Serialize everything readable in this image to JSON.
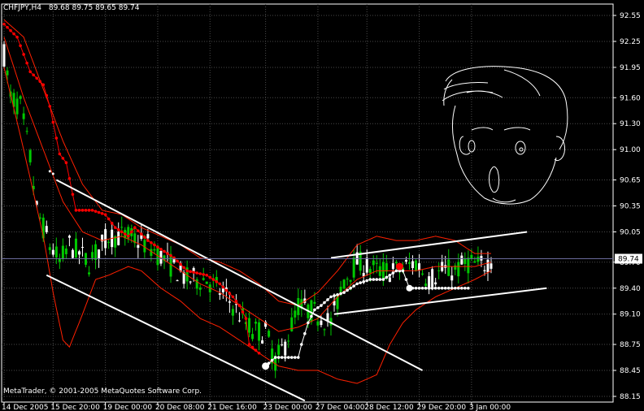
{
  "header": {
    "symbol": "CHFJPY,H4",
    "quote": "89.68 89.75 89.65 89.74"
  },
  "footer": {
    "copyright": "MetaTrader, © 2001-2005 MetaQuotes Software Corp."
  },
  "current_price": {
    "label": "89.74",
    "value": 89.74
  },
  "colors": {
    "background": "#000000",
    "grid": "#4a4a4a",
    "axis": "#ffffff",
    "candle_up": "#ffffff",
    "candle_down": "#00c800",
    "bollinger": "#ff2000",
    "sar": "#ff0000",
    "step_line": "#ffffff",
    "trendline": "#ffffff"
  },
  "chart_data": {
    "type": "candlestick",
    "title": "CHFJPY,H4",
    "ylim": [
      88.15,
      92.55
    ],
    "y_ticks": [
      92.55,
      92.25,
      91.95,
      91.6,
      91.3,
      91.0,
      90.65,
      90.35,
      90.05,
      89.7,
      89.4,
      89.1,
      88.75,
      88.45,
      88.15
    ],
    "y_tick_labels": [
      "92.55",
      "92.25",
      "91.95",
      "91.60",
      "91.30",
      "91.00",
      "90.65",
      "90.35",
      "90.05",
      "89.70",
      "89.40",
      "89.10",
      "88.75",
      "88.45",
      "88.15"
    ],
    "x_labels": [
      {
        "bar": 0,
        "label": "14 Dec 2005"
      },
      {
        "bar": 15,
        "label": "15 Dec 20:00"
      },
      {
        "bar": 31,
        "label": "19 Dec 00:00"
      },
      {
        "bar": 47,
        "label": "20 Dec 08:00"
      },
      {
        "bar": 63,
        "label": "21 Dec 16:00"
      },
      {
        "bar": 80,
        "label": "23 Dec 00:00"
      },
      {
        "bar": 96,
        "label": "27 Dec 04:00"
      },
      {
        "bar": 111,
        "label": "28 Dec 12:00"
      },
      {
        "bar": 127,
        "label": "29 Dec 20:00"
      },
      {
        "bar": 143,
        "label": "3 Jan 00:00"
      }
    ],
    "bar_count": 150,
    "series": [
      {
        "kind": "price",
        "anchors": [
          [
            0,
            92.1
          ],
          [
            2,
            91.6
          ],
          [
            5,
            91.5
          ],
          [
            8,
            90.9
          ],
          [
            10,
            90.3
          ],
          [
            14,
            89.9
          ],
          [
            17,
            89.7
          ],
          [
            20,
            89.9
          ],
          [
            26,
            89.7
          ],
          [
            32,
            90.0
          ],
          [
            38,
            90.0
          ],
          [
            44,
            89.9
          ],
          [
            50,
            89.7
          ],
          [
            56,
            89.5
          ],
          [
            62,
            89.5
          ],
          [
            68,
            89.3
          ],
          [
            72,
            89.1
          ],
          [
            76,
            88.9
          ],
          [
            80,
            88.9
          ],
          [
            83,
            88.55
          ],
          [
            86,
            88.75
          ],
          [
            90,
            89.2
          ],
          [
            96,
            89.1
          ],
          [
            100,
            89.0
          ],
          [
            104,
            89.5
          ],
          [
            108,
            89.7
          ],
          [
            114,
            89.6
          ],
          [
            120,
            89.6
          ],
          [
            126,
            89.7
          ],
          [
            130,
            89.5
          ],
          [
            134,
            89.6
          ],
          [
            138,
            89.6
          ],
          [
            142,
            89.7
          ],
          [
            146,
            89.65
          ],
          [
            149,
            89.74
          ]
        ]
      },
      {
        "name": "bollinger-upper",
        "kind": "line",
        "anchors": [
          [
            0,
            92.5
          ],
          [
            6,
            92.3
          ],
          [
            12,
            91.7
          ],
          [
            18,
            91.1
          ],
          [
            24,
            90.6
          ],
          [
            30,
            90.3
          ],
          [
            36,
            90.25
          ],
          [
            42,
            90.1
          ],
          [
            48,
            90.0
          ],
          [
            54,
            89.9
          ],
          [
            60,
            89.75
          ],
          [
            66,
            89.7
          ],
          [
            72,
            89.6
          ],
          [
            78,
            89.45
          ],
          [
            84,
            89.25
          ],
          [
            90,
            89.2
          ],
          [
            96,
            89.35
          ],
          [
            102,
            89.6
          ],
          [
            108,
            89.9
          ],
          [
            114,
            90.0
          ],
          [
            120,
            89.95
          ],
          [
            126,
            89.95
          ],
          [
            132,
            90.0
          ],
          [
            138,
            89.95
          ],
          [
            144,
            89.8
          ],
          [
            149,
            89.8
          ]
        ]
      },
      {
        "name": "bollinger-middle",
        "kind": "line",
        "anchors": [
          [
            0,
            92.3
          ],
          [
            6,
            91.6
          ],
          [
            12,
            91.0
          ],
          [
            18,
            90.4
          ],
          [
            24,
            90.05
          ],
          [
            30,
            89.95
          ],
          [
            36,
            90.0
          ],
          [
            42,
            89.9
          ],
          [
            48,
            89.75
          ],
          [
            54,
            89.6
          ],
          [
            60,
            89.45
          ],
          [
            66,
            89.35
          ],
          [
            72,
            89.2
          ],
          [
            78,
            89.05
          ],
          [
            84,
            88.9
          ],
          [
            90,
            88.95
          ],
          [
            96,
            89.05
          ],
          [
            102,
            89.3
          ],
          [
            108,
            89.5
          ],
          [
            114,
            89.6
          ],
          [
            120,
            89.6
          ],
          [
            126,
            89.6
          ],
          [
            132,
            89.65
          ],
          [
            138,
            89.65
          ],
          [
            144,
            89.65
          ],
          [
            149,
            89.7
          ]
        ]
      },
      {
        "name": "bollinger-lower",
        "kind": "line",
        "anchors": [
          [
            0,
            91.95
          ],
          [
            6,
            91.0
          ],
          [
            12,
            90.0
          ],
          [
            15,
            89.35
          ],
          [
            18,
            88.8
          ],
          [
            20,
            88.72
          ],
          [
            24,
            89.1
          ],
          [
            28,
            89.5
          ],
          [
            32,
            89.55
          ],
          [
            38,
            89.65
          ],
          [
            42,
            89.6
          ],
          [
            48,
            89.4
          ],
          [
            54,
            89.25
          ],
          [
            60,
            89.05
          ],
          [
            66,
            88.95
          ],
          [
            72,
            88.8
          ],
          [
            78,
            88.65
          ],
          [
            84,
            88.5
          ],
          [
            90,
            88.45
          ],
          [
            96,
            88.45
          ],
          [
            102,
            88.35
          ],
          [
            108,
            88.3
          ],
          [
            114,
            88.4
          ],
          [
            118,
            88.75
          ],
          [
            122,
            89.0
          ],
          [
            126,
            89.15
          ],
          [
            132,
            89.3
          ],
          [
            138,
            89.4
          ],
          [
            144,
            89.5
          ],
          [
            149,
            89.6
          ]
        ]
      },
      {
        "name": "parabolic-sar-red",
        "kind": "dots",
        "anchors": [
          [
            0,
            92.45
          ],
          [
            4,
            92.3
          ],
          [
            8,
            91.9
          ],
          [
            12,
            91.75
          ],
          [
            14,
            91.5
          ],
          [
            17,
            90.95
          ],
          [
            19,
            90.85
          ],
          [
            22,
            90.3
          ],
          [
            27,
            90.3
          ],
          [
            31,
            90.25
          ],
          [
            34,
            90.1
          ],
          [
            38,
            90.0
          ],
          [
            40,
            90.1
          ],
          [
            44,
            89.95
          ],
          [
            48,
            89.85
          ],
          [
            52,
            89.75
          ],
          [
            56,
            89.6
          ],
          [
            62,
            89.55
          ],
          [
            66,
            89.45
          ],
          [
            70,
            89.3
          ],
          [
            72,
            89.2
          ],
          [
            74,
            89.05
          ],
          [
            75,
            88.75
          ],
          [
            78,
            88.65
          ]
        ]
      },
      {
        "name": "step-line",
        "kind": "dots",
        "anchors": [
          [
            80,
            88.5
          ],
          [
            83,
            88.6
          ],
          [
            86,
            88.6
          ],
          [
            90,
            88.6
          ],
          [
            91,
            88.75
          ],
          [
            93,
            89.0
          ],
          [
            95,
            89.15
          ],
          [
            97,
            89.2
          ],
          [
            100,
            89.3
          ],
          [
            104,
            89.35
          ],
          [
            108,
            89.45
          ],
          [
            112,
            89.5
          ],
          [
            116,
            89.5
          ],
          [
            120,
            89.6
          ],
          [
            122,
            89.6
          ],
          [
            124,
            89.4
          ],
          [
            132,
            89.4
          ],
          [
            138,
            89.4
          ],
          [
            142,
            89.4
          ]
        ]
      },
      {
        "name": "sar-marker",
        "kind": "marker",
        "anchors": [
          [
            121,
            89.65
          ]
        ]
      }
    ],
    "trendlines": [
      {
        "name": "trendline-upper-descending",
        "from": [
          16,
          90.65
        ],
        "to": [
          128,
          88.45
        ]
      },
      {
        "name": "trendline-lower-descending",
        "from": [
          13,
          89.55
        ],
        "to": [
          92,
          88.1
        ]
      },
      {
        "name": "trendline-upper-ascending",
        "from": [
          100,
          89.75
        ],
        "to": [
          160,
          90.05
        ]
      },
      {
        "name": "trendline-lower-ascending",
        "from": [
          101,
          89.1
        ],
        "to": [
          166,
          89.4
        ]
      }
    ]
  }
}
